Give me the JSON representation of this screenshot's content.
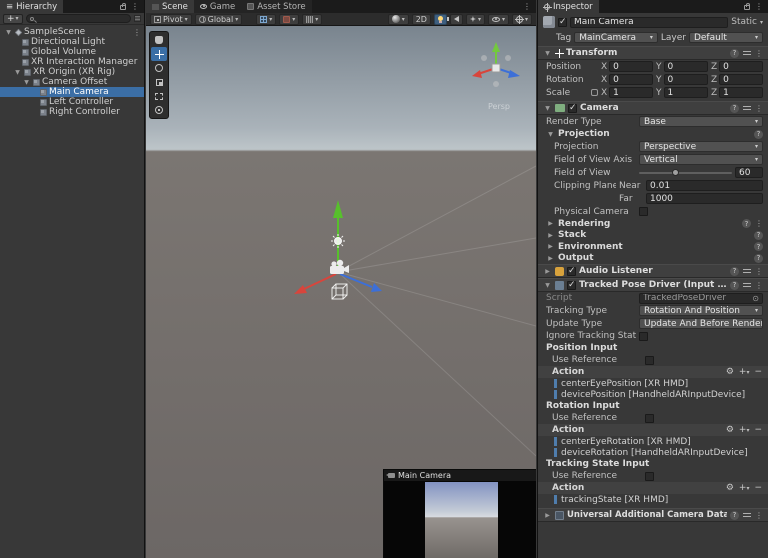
{
  "colors": {
    "selection_blue": "#3B6EA5",
    "action_bar_blue": "#4F7DAD",
    "toolbar_active_blue": "#3E5F80",
    "sky_top": "#79848E",
    "sky_horizon": "#BDC5C9",
    "ground": "#6C6765"
  },
  "hierarchy": {
    "tab": "Hierarchy",
    "create_label": "+",
    "items": [
      {
        "label": "SampleScene"
      },
      {
        "label": "Directional Light"
      },
      {
        "label": "Global Volume"
      },
      {
        "label": "XR Interaction Manager"
      },
      {
        "label": "XR Origin (XR Rig)"
      },
      {
        "label": "Camera Offset"
      },
      {
        "label": "Main Camera"
      },
      {
        "label": "Left Controller"
      },
      {
        "label": "Right Controller"
      }
    ]
  },
  "scene_view": {
    "tabs": {
      "scene": "Scene",
      "game": "Game",
      "asset_store": "Asset Store"
    },
    "toolbar": {
      "pivot": "Pivot",
      "global": "Global",
      "mode_2d": "2D"
    },
    "gizmo_label": "Persp",
    "preview_title": "Main Camera"
  },
  "inspector": {
    "tab": "Inspector",
    "header": {
      "name": "Main Camera",
      "static_label": "Static",
      "tag_label": "Tag",
      "tag_value": "MainCamera",
      "layer_label": "Layer",
      "layer_value": "Default"
    },
    "axis": {
      "x": "X",
      "y": "Y",
      "z": "Z"
    },
    "transform": {
      "title": "Transform",
      "position": {
        "label": "Position",
        "x": "0",
        "y": "0",
        "z": "0"
      },
      "rotation": {
        "label": "Rotation",
        "x": "0",
        "y": "0",
        "z": "0"
      },
      "scale": {
        "label": "Scale",
        "x": "1",
        "y": "1",
        "z": "1"
      }
    },
    "camera": {
      "title": "Camera",
      "render_type_label": "Render Type",
      "render_type_value": "Base",
      "projection_section": "Projection",
      "projection_label": "Projection",
      "projection_value": "Perspective",
      "fov_axis_label": "Field of View Axis",
      "fov_axis_value": "Vertical",
      "fov_label": "Field of View",
      "fov_value": "60",
      "clipping_label": "Clipping Planes",
      "near_label": "Near",
      "near_value": "0.01",
      "far_label": "Far",
      "far_value": "1000",
      "physical_label": "Physical Camera",
      "rendering": "Rendering",
      "stack": "Stack",
      "environment": "Environment",
      "output": "Output"
    },
    "audio_listener": {
      "title": "Audio Listener"
    },
    "tpd": {
      "title": "Tracked Pose Driver (Input System)",
      "script_label": "Script",
      "script_value": "TrackedPoseDriver",
      "tracking_type_label": "Tracking Type",
      "tracking_type_value": "Rotation And Position",
      "update_type_label": "Update Type",
      "update_type_value": "Update And Before Render",
      "ignore_label": "Ignore Tracking State",
      "use_reference_label": "Use Reference",
      "action_label": "Action",
      "position_input": {
        "title": "Position Input",
        "items": [
          "centerEyePosition [XR HMD]",
          "devicePosition [HandheldARInputDevice]"
        ]
      },
      "rotation_input": {
        "title": "Rotation Input",
        "items": [
          "centerEyeRotation [XR HMD]",
          "deviceRotation [HandheldARInputDevice]"
        ]
      },
      "tracking_state_input": {
        "title": "Tracking State Input",
        "items": [
          "trackingState [XR HMD]"
        ]
      }
    },
    "universal": {
      "title": "Universal Additional Camera Data (Script"
    }
  }
}
